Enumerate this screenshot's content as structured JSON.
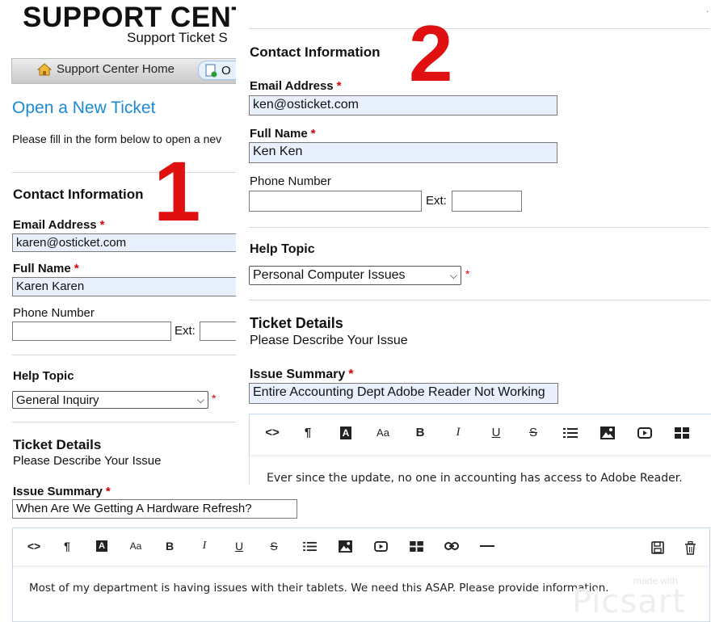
{
  "header": {
    "title": "SUPPORT CENT",
    "subtitle": "Support Ticket S"
  },
  "nav": {
    "home_label": "Support Center Home",
    "open_label": "O"
  },
  "left": {
    "heading": "Open a New Ticket",
    "intro": "Please fill in the form below to open a nev",
    "marker": "1",
    "contact_heading": "Contact Information",
    "email_label": "Email Address",
    "email_value": "karen@osticket.com",
    "name_label": "Full Name",
    "name_value": "Karen Karen",
    "phone_label": "Phone Number",
    "ext_label": "Ext:",
    "help_heading": "Help Topic",
    "help_value": "General Inquiry",
    "ticket_heading": "Ticket Details",
    "ticket_sub": "Please Describe Your Issue",
    "summary_label": "Issue Summary",
    "summary_value": "When Are We Getting A Hardware Refresh?",
    "body_text": "Most of my department is having issues with their tablets. We need this ASAP. Please provide information."
  },
  "right": {
    "marker": "2",
    "contact_heading": "Contact Information",
    "email_label": "Email Address",
    "email_value": "ken@osticket.com",
    "name_label": "Full Name",
    "name_value": "Ken Ken",
    "phone_label": "Phone Number",
    "ext_label": "Ext:",
    "help_heading": "Help Topic",
    "help_value": "Personal Computer Issues",
    "ticket_heading": "Ticket Details",
    "ticket_sub": "Please Describe Your Issue",
    "summary_label": "Issue Summary",
    "summary_value": "Entire Accounting Dept Adobe Reader Not Working",
    "body_text": "Ever since the update, no one in accounting has access to Adobe Reader."
  },
  "required_mark": "*",
  "toolbar": {
    "code": "<>",
    "paragraph": "¶",
    "font": "A",
    "size": "Aa",
    "bold": "B",
    "italic": "I",
    "underline": "U",
    "strike": "S"
  },
  "watermark": {
    "top": "made with",
    "brand": "Picsart"
  },
  "colors": {
    "link_blue": "#1a8ad4",
    "marker_red": "#e01010",
    "field_fill": "#e8f0fe"
  }
}
